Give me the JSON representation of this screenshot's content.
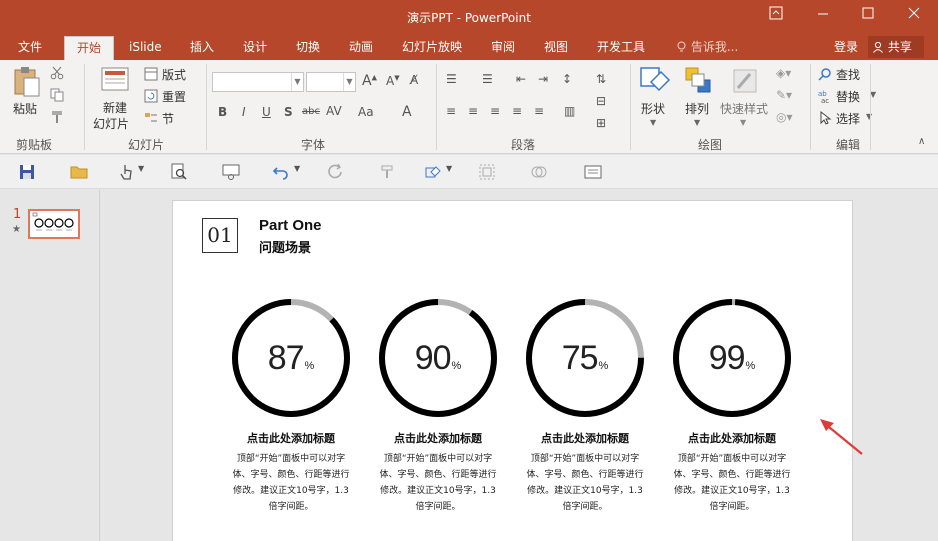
{
  "window": {
    "title": "演示PPT - PowerPoint"
  },
  "tabs": [
    {
      "label": "文件",
      "active": false
    },
    {
      "label": "开始",
      "active": true
    },
    {
      "label": "iSlide",
      "active": false
    },
    {
      "label": "插入",
      "active": false
    },
    {
      "label": "设计",
      "active": false
    },
    {
      "label": "切换",
      "active": false
    },
    {
      "label": "动画",
      "active": false
    },
    {
      "label": "幻灯片放映",
      "active": false
    },
    {
      "label": "审阅",
      "active": false
    },
    {
      "label": "视图",
      "active": false
    },
    {
      "label": "开发工具",
      "active": false
    }
  ],
  "tell_me": "告诉我...",
  "account": {
    "login": "登录",
    "share": "共享"
  },
  "ribbon": {
    "clipboard": {
      "paste": "粘贴",
      "group": "剪贴板"
    },
    "slides": {
      "new_slide_1": "新建",
      "new_slide_2": "幻灯片",
      "layout": "版式",
      "reset": "重置",
      "section": "节",
      "group": "幻灯片"
    },
    "font": {
      "group": "字体"
    },
    "paragraph": {
      "group": "段落"
    },
    "drawing": {
      "shape": "形状",
      "arrange": "排列",
      "quick_styles": "快速样式",
      "group": "绘图"
    },
    "editing": {
      "find": "查找",
      "replace": "替换",
      "select": "选择",
      "group": "编辑"
    }
  },
  "thumbnail": {
    "number": "1",
    "star": "★"
  },
  "slide": {
    "number": "01",
    "title": "Part One",
    "subtitle": "问题场景",
    "cards": [
      {
        "value": "87",
        "unit": "%",
        "title": "点击此处添加标题",
        "body": "顶部“开始”面板中可以对字体、字号、颜色、行距等进行修改。建议正文10号字，1.3倍字间距。"
      },
      {
        "value": "90",
        "unit": "%",
        "title": "点击此处添加标题",
        "body": "顶部“开始”面板中可以对字体、字号、颜色、行距等进行修改。建议正文10号字，1.3倍字间距。"
      },
      {
        "value": "75",
        "unit": "%",
        "title": "点击此处添加标题",
        "body": "顶部“开始”面板中可以对字体、字号、颜色、行距等进行修改。建议正文10号字，1.3倍字间距。"
      },
      {
        "value": "99",
        "unit": "%",
        "title": "点击此处添加标题",
        "body": "顶部“开始”面板中可以对字体、字号、颜色、行距等进行修改。建议正文10号字，1.3倍字间距。"
      }
    ]
  },
  "colors": {
    "accent": "#b7472a",
    "ring_fill": "#000000",
    "ring_track": "#b3b3b3",
    "arrow": "#e03a3a"
  }
}
